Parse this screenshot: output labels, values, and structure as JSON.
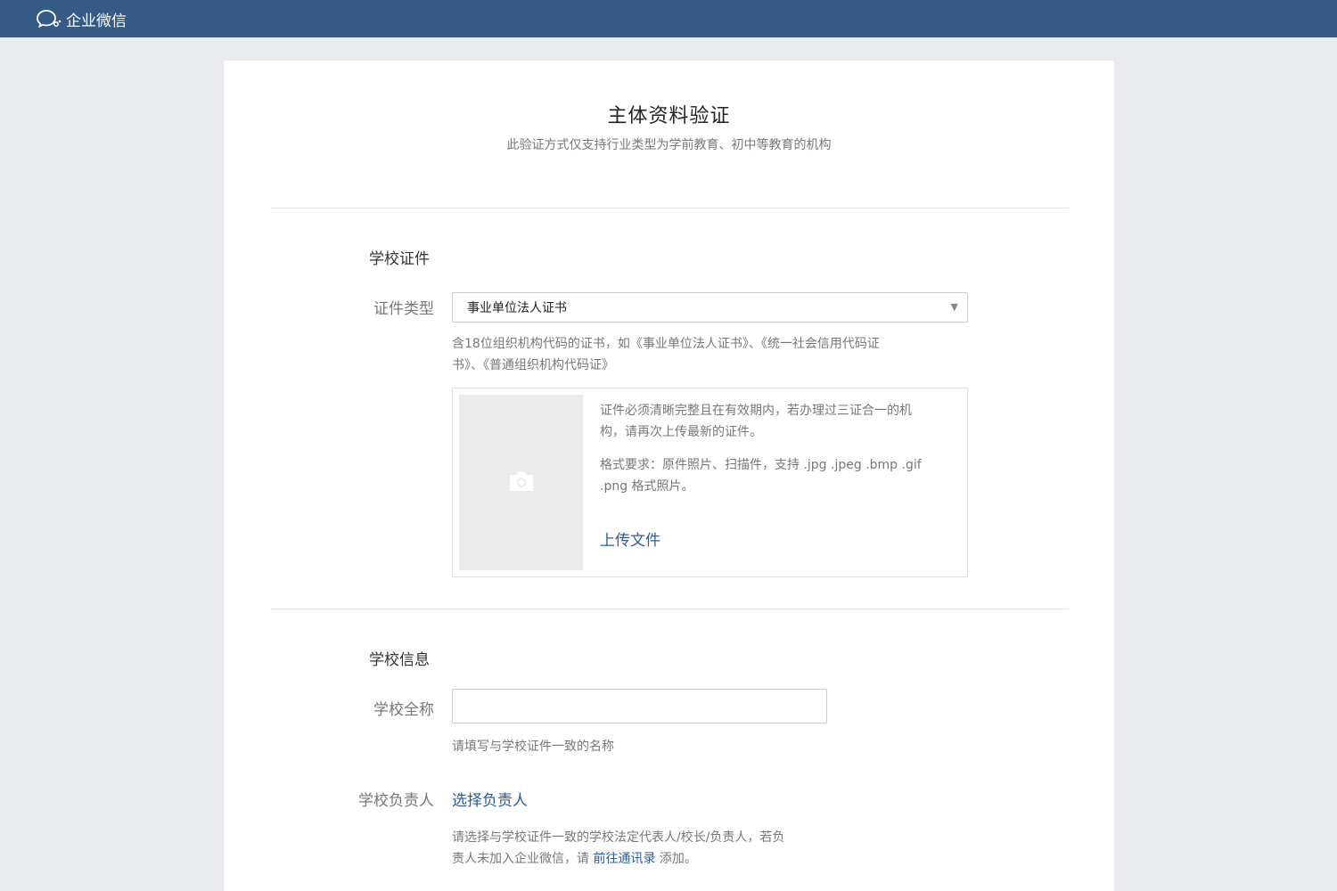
{
  "app": {
    "brand_name": "企业微信",
    "brand_icon": "chat-bubble-icon"
  },
  "header": {
    "title": "主体资料验证",
    "subtitle": "此验证方式仅支持行业类型为学前教育、初中等教育的机构"
  },
  "certificate_section": {
    "title": "学校证件",
    "type_label": "证件类型",
    "selected_type": "事业单位法人证书",
    "type_hint_line1": "含18位组织机构代码的证书，如《事业单位法人证书》、《统一社会信用代码证",
    "type_hint_line2": "书》、《普通组织机构代码证》",
    "upload": {
      "note_line1": "证件必须清晰完整且在有效期内，若办理过三证合一的机",
      "note_line2": "构，请再次上传最新的证件。",
      "format_line1": "格式要求：原件照片、扫描件，支持 .jpg .jpeg .bmp .gif",
      "format_line2": ".png 格式照片。",
      "upload_label": "上传文件",
      "preview_icon": "camera-icon"
    }
  },
  "school_section": {
    "title": "学校信息",
    "name_label": "学校全称",
    "name_value": "",
    "name_hint": "请填写与学校证件一致的名称",
    "principal_label": "学校负责人",
    "principal_link": "选择负责人",
    "principal_hint_line1": "请选择与学校证件一致的学校法定代表人/校长/负责人，若负",
    "principal_hint_line2_prefix": "责人未加入企业微信，请 ",
    "principal_hint_link": "前往通讯录",
    "principal_hint_line2_suffix": " 添加。"
  },
  "colors": {
    "topbar": "#345a85",
    "link": "#2a5b9a",
    "background": "#e9ebee"
  }
}
